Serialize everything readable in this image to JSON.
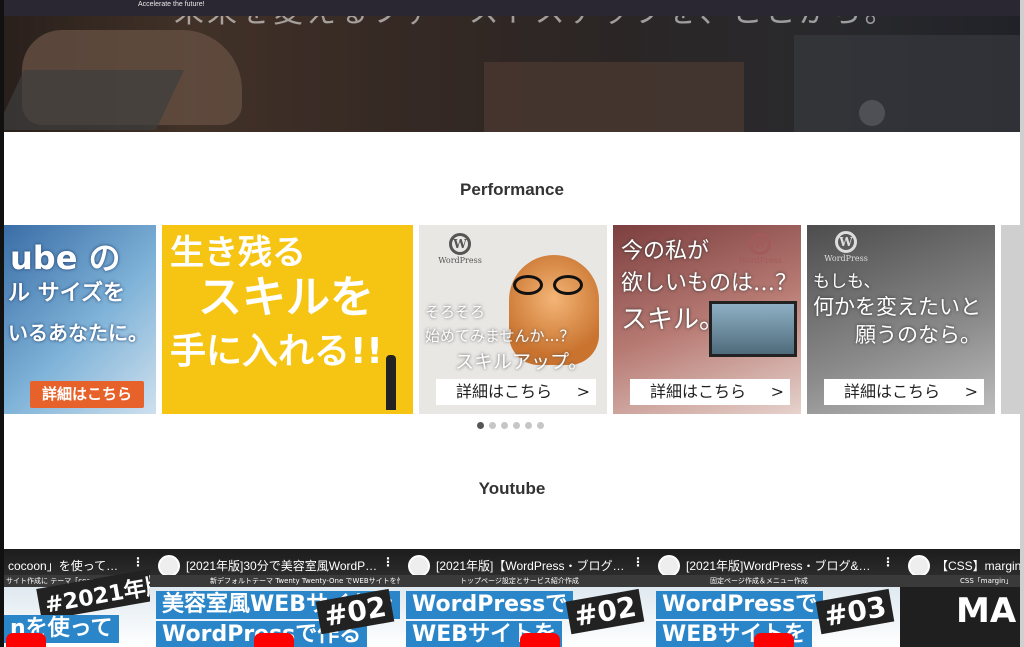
{
  "header": {
    "tagline": "Accelerate the future!",
    "hero_title": "未来を変えるファーストステップを、ここから。"
  },
  "performance": {
    "title": "Performance",
    "slides": [
      {
        "l1": "ube の",
        "l2": "ル サイズを",
        "l3": "いるあなたに。",
        "cta": "詳細はこちら"
      },
      {
        "l1": "生き残る",
        "l2": "スキルを",
        "l3": "手に入れる!!"
      },
      {
        "brand": "WordPress",
        "l1": "そろそろ",
        "l2": "始めてみませんか…？",
        "l3": "スキルアップ。",
        "cta": "詳細はこちら"
      },
      {
        "brand": "WordPress",
        "l1": "今の私が",
        "l2": "欲しいものは…？",
        "l3": "スキル。",
        "cta": "詳細はこちら"
      },
      {
        "brand": "WordPress",
        "l1": "もしも、",
        "l2": "何かを変えたいと",
        "l3": "願うのなら。",
        "cta": "詳細はこちら"
      }
    ],
    "dots_total": 6,
    "dots_active_index": 0
  },
  "youtube": {
    "title": "Youtube",
    "videos": [
      {
        "title": "cocoon」を使って…",
        "sub": "サイト作成に テーマ「cocoon」を使う",
        "badge": "#2021年版",
        "big1": "nを使って"
      },
      {
        "title": "[2021年版]30分で美容室風WordP…",
        "sub": "新デフォルトテーマ Twenty Twenty-One でWEBサイトを作る",
        "big1": "美容室風WEBサイトを",
        "big2": "WordPressで作る",
        "num": "#02"
      },
      {
        "title": "[2021年版]【WordPress・ブログ…",
        "sub": "トップページ設定とサービス紹介作成",
        "big1": "WordPressで",
        "big2": "WEBサイトを",
        "num": "#02"
      },
      {
        "title": "[2021年版]WordPress・ブログ&…",
        "sub": "固定ページ作成＆メニュー作成",
        "big1": "WordPressで",
        "big2": "WEBサイトを",
        "num": "#03"
      },
      {
        "title": "【CSS】margin",
        "sub": "CSS「margin」",
        "big1": "MA"
      }
    ]
  }
}
